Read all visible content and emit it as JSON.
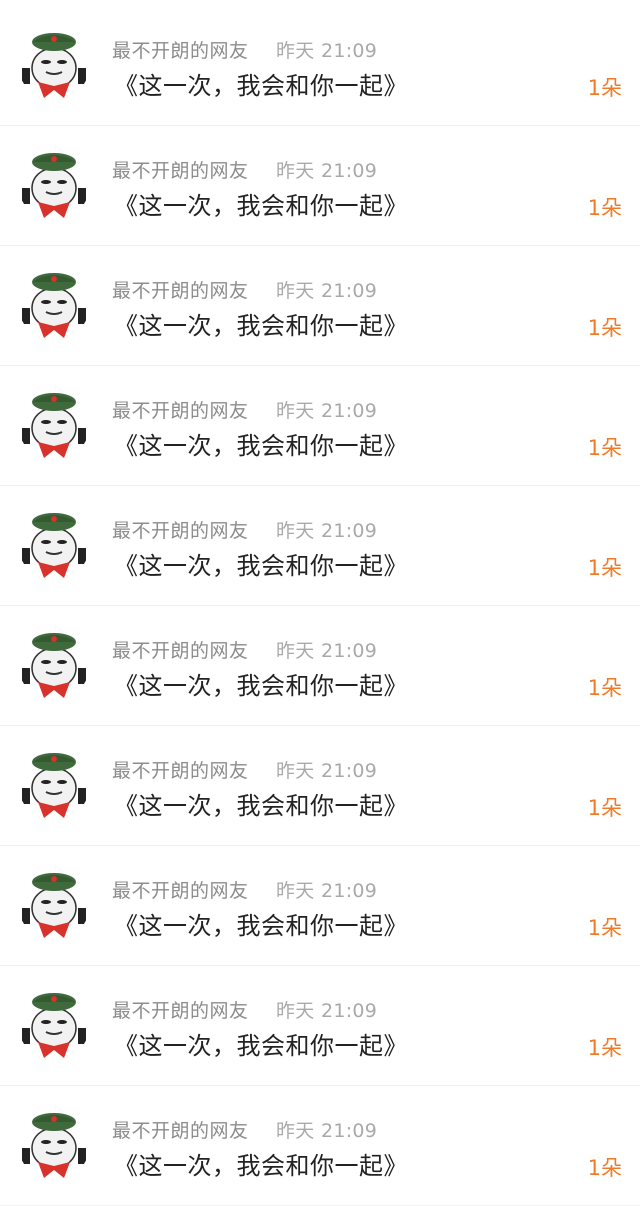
{
  "items": [
    {
      "author": "最不开朗的网友",
      "time": "昨天 21:09",
      "text": "《这一次，我会和你一起》",
      "count": "1朵"
    },
    {
      "author": "最不开朗的网友",
      "time": "昨天 21:09",
      "text": "《这一次，我会和你一起》",
      "count": "1朵"
    },
    {
      "author": "最不开朗的网友",
      "time": "昨天 21:09",
      "text": "《这一次，我会和你一起》",
      "count": "1朵"
    },
    {
      "author": "最不开朗的网友",
      "time": "昨天 21:09",
      "text": "《这一次，我会和你一起》",
      "count": "1朵"
    },
    {
      "author": "最不开朗的网友",
      "time": "昨天 21:09",
      "text": "《这一次，我会和你一起》",
      "count": "1朵"
    },
    {
      "author": "最不开朗的网友",
      "time": "昨天 21:09",
      "text": "《这一次，我会和你一起》",
      "count": "1朵"
    },
    {
      "author": "最不开朗的网友",
      "time": "昨天 21:09",
      "text": "《这一次，我会和你一起》",
      "count": "1朵"
    },
    {
      "author": "最不开朗的网友",
      "time": "昨天 21:09",
      "text": "《这一次，我会和你一起》",
      "count": "1朵"
    },
    {
      "author": "最不开朗的网友",
      "time": "昨天 21:09",
      "text": "《这一次，我会和你一起》",
      "count": "1朵"
    },
    {
      "author": "最不开朗的网友",
      "time": "昨天 21:09",
      "text": "《这一次，我会和你一起》",
      "count": "1朵"
    }
  ],
  "avatar_icon": "meme-panda-soldier-avatar",
  "colors": {
    "name": "#8c8c8c",
    "time": "#a9a9a9",
    "text": "#222222",
    "count": "#f07b26",
    "hat": "#3f6b3c",
    "scarf": "#d8322c"
  }
}
